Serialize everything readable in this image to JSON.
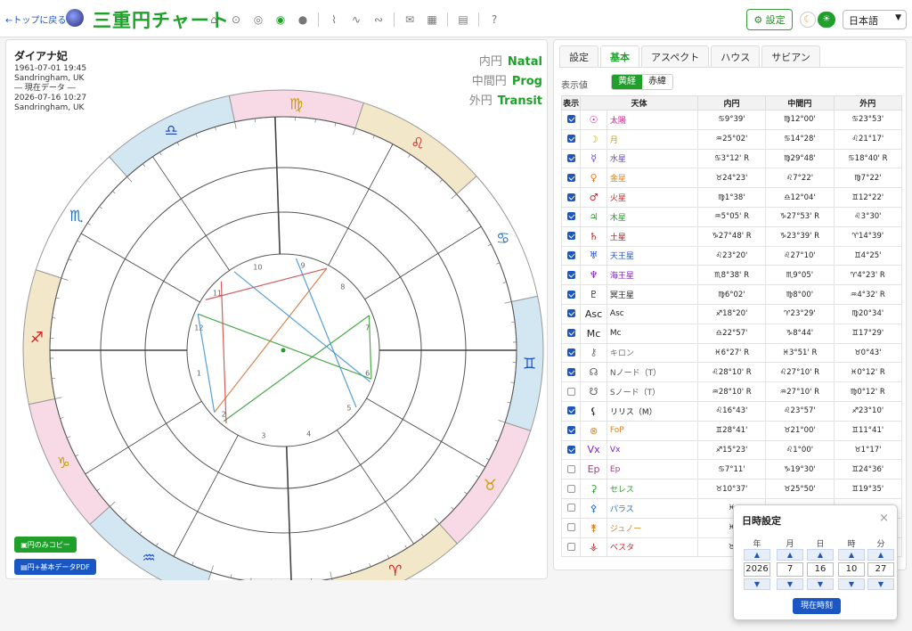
{
  "header": {
    "back_label": "←トップに戻る",
    "app_title": "三重円チャート",
    "settings_label": "⚙ 設定",
    "language": "日本語",
    "nav_icons": [
      "home-icon",
      "circle-dot-icon",
      "double-circle-icon",
      "triple-circle-icon",
      "filled-circle-icon",
      "line-chart-icon",
      "wave-icon",
      "wave-alt-icon",
      "mail-icon",
      "calendar-icon",
      "clipboard-icon",
      "help-icon"
    ]
  },
  "left": {
    "name": "ダイアナ妃",
    "birth_date": "1961-07-01 19:45",
    "birth_place": "Sandringham, UK",
    "current_label": "― 現在データ ―",
    "current_date": "2026-07-16 10:27",
    "current_place": "Sandringham, UK",
    "rings": [
      {
        "label": "内円",
        "value": "Natal"
      },
      {
        "label": "中間円",
        "value": "Prog"
      },
      {
        "label": "外円",
        "value": "Transit"
      }
    ],
    "btn_copy": "円のみコピー",
    "btn_pdf": "円+基本データPDF"
  },
  "tabs": [
    "設定",
    "基本",
    "アスペクト",
    "ハウス",
    "サビアン"
  ],
  "active_tab": "基本",
  "display": {
    "label": "表示値",
    "options": [
      "黄経",
      "赤緯"
    ],
    "selected": "黄経"
  },
  "table": {
    "headers": [
      "表示",
      "天体",
      "内円",
      "中間円",
      "外円"
    ],
    "rows": [
      {
        "checked": true,
        "glyph": "☉",
        "name": "太陽",
        "color": "#d02090",
        "natal": "♋9°39'",
        "prog": "♍12°00'",
        "transit": "♋23°53'"
      },
      {
        "checked": true,
        "glyph": "☽",
        "name": "月",
        "color": "#c8a000",
        "natal": "♒25°02'",
        "prog": "♋14°28'",
        "transit": "♌21°17'"
      },
      {
        "checked": true,
        "glyph": "☿",
        "name": "水星",
        "color": "#6a40d0",
        "natal": "♋3°12' R",
        "prog": "♍29°48'",
        "transit": "♋18°40' R"
      },
      {
        "checked": true,
        "glyph": "♀",
        "name": "金星",
        "color": "#e08020",
        "natal": "♉24°23'",
        "prog": "♌7°22'",
        "transit": "♍7°22'"
      },
      {
        "checked": true,
        "glyph": "♂",
        "name": "火星",
        "color": "#d02020",
        "natal": "♍1°38'",
        "prog": "♎12°04'",
        "transit": "♊12°22'"
      },
      {
        "checked": true,
        "glyph": "♃",
        "name": "木星",
        "color": "#20a020",
        "natal": "♒5°05' R",
        "prog": "♑27°53' R",
        "transit": "♌3°30'"
      },
      {
        "checked": true,
        "glyph": "♄",
        "name": "土星",
        "color": "#a02020",
        "natal": "♑27°48' R",
        "prog": "♑23°39' R",
        "transit": "♈14°39'"
      },
      {
        "checked": true,
        "glyph": "♅",
        "name": "天王星",
        "color": "#2050c0",
        "natal": "♌23°20'",
        "prog": "♌27°10'",
        "transit": "♊4°25'"
      },
      {
        "checked": true,
        "glyph": "♆",
        "name": "海王星",
        "color": "#8020c0",
        "natal": "♏8°38' R",
        "prog": "♏9°05'",
        "transit": "♈4°23' R"
      },
      {
        "checked": true,
        "glyph": "♇",
        "name": "冥王星",
        "color": "#222222",
        "natal": "♍6°02'",
        "prog": "♍8°00'",
        "transit": "♒4°32' R"
      },
      {
        "checked": true,
        "glyph": "Asc",
        "name": "Asc",
        "color": "#222222",
        "natal": "♐18°20'",
        "prog": "♈23°29'",
        "transit": "♍20°34'"
      },
      {
        "checked": true,
        "glyph": "Mc",
        "name": "Mc",
        "color": "#222222",
        "natal": "♎22°57'",
        "prog": "♑8°44'",
        "transit": "♊17°29'"
      },
      {
        "checked": true,
        "glyph": "⚷",
        "name": "キロン",
        "color": "#777777",
        "natal": "♓6°27' R",
        "prog": "♓3°51' R",
        "transit": "♉0°43'"
      },
      {
        "checked": true,
        "glyph": "☊",
        "name": "Nノード（T）",
        "color": "#555555",
        "natal": "♌28°10' R",
        "prog": "♌27°10' R",
        "transit": "♓0°12' R"
      },
      {
        "checked": false,
        "glyph": "☋",
        "name": "Sノード（T）",
        "color": "#555555",
        "natal": "♒28°10' R",
        "prog": "♒27°10' R",
        "transit": "♍0°12' R"
      },
      {
        "checked": true,
        "glyph": "⚸",
        "name": "リリス（M）",
        "color": "#222222",
        "natal": "♌16°43'",
        "prog": "♌23°57'",
        "transit": "♐23°10'"
      },
      {
        "checked": true,
        "glyph": "⊗",
        "name": "FoP",
        "color": "#e08020",
        "natal": "♊28°41'",
        "prog": "♉21°00'",
        "transit": "♊11°41'"
      },
      {
        "checked": true,
        "glyph": "Vx",
        "name": "Vx",
        "color": "#8020c0",
        "natal": "♐15°23'",
        "prog": "♌1°00'",
        "transit": "♉1°17'"
      },
      {
        "checked": false,
        "glyph": "Ep",
        "name": "Ep",
        "color": "#a04080",
        "natal": "♋7°11'",
        "prog": "♑19°30'",
        "transit": "♊24°36'"
      },
      {
        "checked": false,
        "glyph": "⚳",
        "name": "セレス",
        "color": "#20a020",
        "natal": "♉10°37'",
        "prog": "♉25°50'",
        "transit": "♊19°35'"
      },
      {
        "checked": false,
        "glyph": "⚴",
        "name": "パラス",
        "color": "#2070c0",
        "natal": "♓",
        "prog": "",
        "transit": ""
      },
      {
        "checked": false,
        "glyph": "⚵",
        "name": "ジュノー",
        "color": "#e08020",
        "natal": "♓",
        "prog": "",
        "transit": ""
      },
      {
        "checked": false,
        "glyph": "⚶",
        "name": "ベスタ",
        "color": "#d02020",
        "natal": "♉",
        "prog": "",
        "transit": ""
      }
    ]
  },
  "datetime_modal": {
    "title": "日時設定",
    "close": "×",
    "fields": [
      {
        "label": "年",
        "value": "2026"
      },
      {
        "label": "月",
        "value": "7"
      },
      {
        "label": "日",
        "value": "16"
      },
      {
        "label": "時",
        "value": "10"
      },
      {
        "label": "分",
        "value": "27"
      }
    ],
    "now_label": "現在時刻"
  },
  "chart": {
    "zodiac": [
      {
        "glyph": "♍",
        "color": "#c8a000"
      },
      {
        "glyph": "♌",
        "color": "#d02020"
      },
      {
        "glyph": "♋",
        "color": "#2070c0"
      },
      {
        "glyph": "♊",
        "color": "#2050c0"
      },
      {
        "glyph": "♉",
        "color": "#c8a000"
      },
      {
        "glyph": "♈",
        "color": "#d02020"
      },
      {
        "glyph": "♓",
        "color": "#2070c0"
      },
      {
        "glyph": "♒",
        "color": "#2050c0"
      },
      {
        "glyph": "♑",
        "color": "#c8a000"
      },
      {
        "glyph": "♐",
        "color": "#d02020"
      },
      {
        "glyph": "♏",
        "color": "#2070c0"
      },
      {
        "glyph": "♎",
        "color": "#2050c0"
      }
    ],
    "house_numbers": [
      "1",
      "2",
      "3",
      "4",
      "5",
      "6",
      "7",
      "8",
      "9",
      "10",
      "11",
      "12"
    ]
  }
}
